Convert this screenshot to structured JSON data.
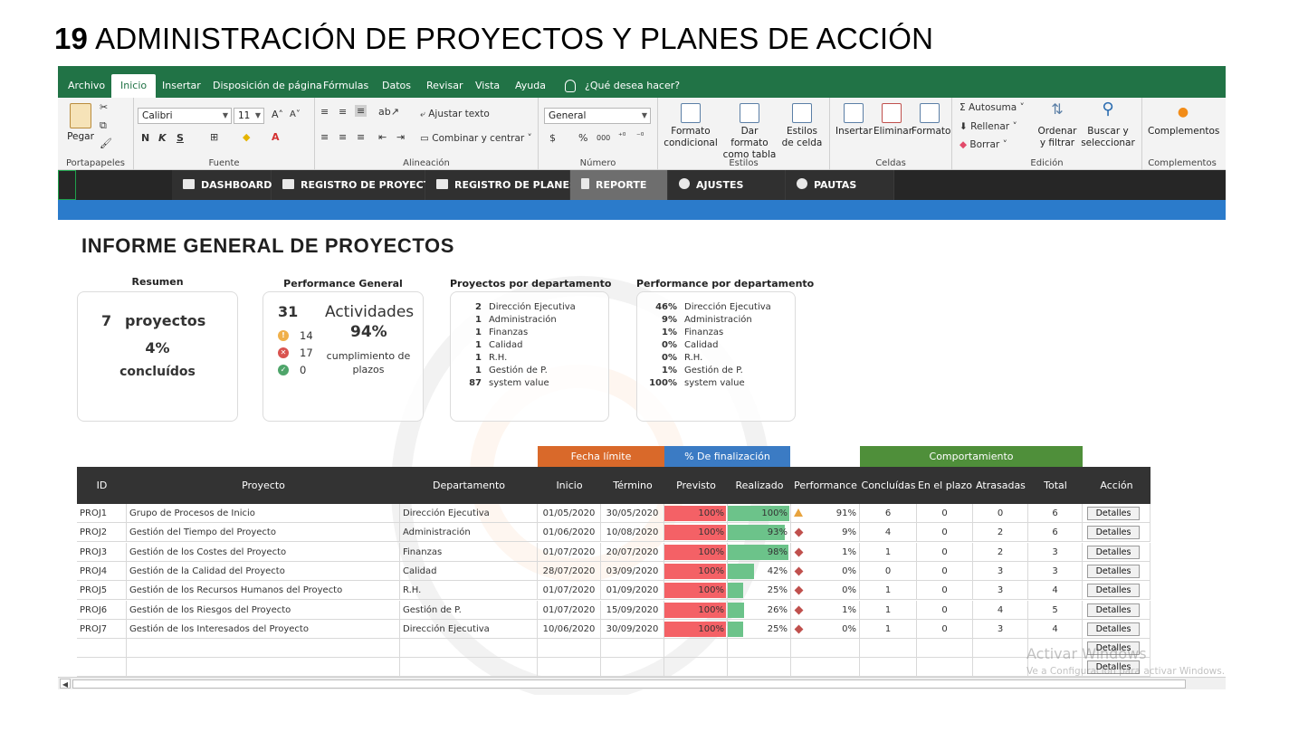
{
  "slide": {
    "number": "19",
    "title": "ADMINISTRACIÓN DE PROYECTOS Y PLANES DE ACCIÓN"
  },
  "ribbon_tabs": [
    "Archivo",
    "Inicio",
    "Insertar",
    "Disposición de página",
    "Fórmulas",
    "Datos",
    "Revisar",
    "Vista",
    "Ayuda",
    "¿Qué desea hacer?"
  ],
  "active_tab": "Inicio",
  "ribbon": {
    "portapapeles": {
      "paste": "Pegar",
      "label": "Portapapeles"
    },
    "fuente": {
      "font": "Calibri",
      "size": "11",
      "label": "Fuente",
      "bold": "N",
      "italic": "K",
      "underline": "S"
    },
    "alineacion": {
      "wrap": "Ajustar texto",
      "merge": "Combinar y centrar",
      "label": "Alineación"
    },
    "numero": {
      "format": "General",
      "currency": "$",
      "percent": "%",
      "thousands": "000",
      "label": "Número"
    },
    "estilos": {
      "cond": "Formato condicional",
      "table": "Dar formato como tabla",
      "cell": "Estilos de celda",
      "label": "Estilos"
    },
    "celdas": {
      "insert": "Insertar",
      "delete": "Eliminar",
      "format": "Formato",
      "label": "Celdas"
    },
    "edicion": {
      "autosum": "Autosuma",
      "fill": "Rellenar",
      "clear": "Borrar",
      "sort": "Ordenar y filtrar",
      "find": "Buscar y seleccionar",
      "label": "Edición"
    },
    "complementos": {
      "addins": "Complementos",
      "label": "Complementos"
    }
  },
  "nav": [
    "DASHBOARD",
    "REGISTRO DE PROYECTOS",
    "REGISTRO DE PLANES",
    "REPORTE",
    "AJUSTES",
    "PAUTAS"
  ],
  "nav_active": "REPORTE",
  "report_title": "INFORME GENERAL DE PROYECTOS",
  "summary": {
    "head": "Resumen",
    "count": "7",
    "word": "proyectos",
    "pct": "4%",
    "label": "concluídos"
  },
  "performance": {
    "head": "Performance General",
    "total": "31",
    "activities": "Actividades",
    "pct": "94%",
    "label": "cumplimiento de plazos",
    "pending": "14",
    "late": "17",
    "done": "0",
    "colors": {
      "pending": "#f0b04a",
      "late": "#d9534f",
      "done": "#4ea56a"
    }
  },
  "by_dept": {
    "head": "Proyectos por departamento",
    "items": [
      {
        "n": "2",
        "name": "Dirección Ejecutiva"
      },
      {
        "n": "1",
        "name": "Administración"
      },
      {
        "n": "1",
        "name": "Finanzas"
      },
      {
        "n": "1",
        "name": "Calidad"
      },
      {
        "n": "1",
        "name": "R.H."
      },
      {
        "n": "1",
        "name": "Gestión de P."
      },
      {
        "n": "87",
        "name": "system value"
      }
    ]
  },
  "perf_dept": {
    "head": "Performance por departamento",
    "items": [
      {
        "n": "46%",
        "name": "Dirección Ejecutiva"
      },
      {
        "n": "9%",
        "name": "Administración"
      },
      {
        "n": "1%",
        "name": "Finanzas"
      },
      {
        "n": "0%",
        "name": "Calidad"
      },
      {
        "n": "0%",
        "name": "R.H."
      },
      {
        "n": "1%",
        "name": "Gestión de P."
      },
      {
        "n": "100%",
        "name": "system value"
      }
    ]
  },
  "table": {
    "groups": {
      "fecha": "Fecha límite",
      "pct": "% De finalización",
      "comp": "Comportamiento"
    },
    "group_colors": {
      "fecha": "#d9692a",
      "pct": "#3b7bc4",
      "comp": "#4f8f3a"
    },
    "headers": [
      "ID",
      "Proyecto",
      "Departamento",
      "Inicio",
      "Término",
      "Previsto",
      "Realizado",
      "Performance",
      "Concluídas",
      "En el plazo",
      "Atrasadas",
      "Total",
      "Acción"
    ],
    "button_label": "Detalles",
    "rows": [
      {
        "id": "PROJ1",
        "proyecto": "Grupo de Procesos de Inicio",
        "depto": "Dirección Ejecutiva",
        "inicio": "01/05/2020",
        "termino": "30/05/2020",
        "previsto": "100%",
        "previsto_v": 1.0,
        "realizado": "100%",
        "realizado_v": 1.0,
        "perf": "91%",
        "perf_icon": "warning",
        "concl": "6",
        "plazo": "0",
        "atras": "0",
        "total": "6"
      },
      {
        "id": "PROJ2",
        "proyecto": "Gestión del Tiempo del Proyecto",
        "depto": "Administración",
        "inicio": "01/06/2020",
        "termino": "10/08/2020",
        "previsto": "100%",
        "previsto_v": 1.0,
        "realizado": "93%",
        "realizado_v": 0.93,
        "perf": "9%",
        "perf_icon": "diamond",
        "concl": "4",
        "plazo": "0",
        "atras": "2",
        "total": "6"
      },
      {
        "id": "PROJ3",
        "proyecto": "Gestión de los Costes del Proyecto",
        "depto": "Finanzas",
        "inicio": "01/07/2020",
        "termino": "20/07/2020",
        "previsto": "100%",
        "previsto_v": 1.0,
        "realizado": "98%",
        "realizado_v": 0.98,
        "perf": "1%",
        "perf_icon": "diamond",
        "concl": "1",
        "plazo": "0",
        "atras": "2",
        "total": "3"
      },
      {
        "id": "PROJ4",
        "proyecto": "Gestión de la Calidad del Proyecto",
        "depto": "Calidad",
        "inicio": "28/07/2020",
        "termino": "03/09/2020",
        "previsto": "100%",
        "previsto_v": 1.0,
        "realizado": "42%",
        "realizado_v": 0.42,
        "perf": "0%",
        "perf_icon": "diamond",
        "concl": "0",
        "plazo": "0",
        "atras": "3",
        "total": "3"
      },
      {
        "id": "PROJ5",
        "proyecto": "Gestión de los Recursos Humanos del Proyecto",
        "depto": "R.H.",
        "inicio": "01/07/2020",
        "termino": "01/09/2020",
        "previsto": "100%",
        "previsto_v": 1.0,
        "realizado": "25%",
        "realizado_v": 0.25,
        "perf": "0%",
        "perf_icon": "diamond",
        "concl": "1",
        "plazo": "0",
        "atras": "3",
        "total": "4"
      },
      {
        "id": "PROJ6",
        "proyecto": "Gestión de los Riesgos del Proyecto",
        "depto": "Gestión de P.",
        "inicio": "01/07/2020",
        "termino": "15/09/2020",
        "previsto": "100%",
        "previsto_v": 1.0,
        "realizado": "26%",
        "realizado_v": 0.26,
        "perf": "1%",
        "perf_icon": "diamond",
        "concl": "1",
        "plazo": "0",
        "atras": "4",
        "total": "5"
      },
      {
        "id": "PROJ7",
        "proyecto": "Gestión de los Interesados del Proyecto",
        "depto": "Dirección Ejecutiva",
        "inicio": "10/06/2020",
        "termino": "30/09/2020",
        "previsto": "100%",
        "previsto_v": 1.0,
        "realizado": "25%",
        "realizado_v": 0.25,
        "perf": "0%",
        "perf_icon": "diamond",
        "concl": "1",
        "plazo": "0",
        "atras": "3",
        "total": "4"
      }
    ],
    "empty_rows": 2,
    "colors": {
      "previsto_bar": "#f46166",
      "realizado_bar": "#6cc38a",
      "perf_icon": "#c0504d"
    }
  },
  "watermark": {
    "line1": "Activar Windows",
    "line2": "Ve a Configuración para activar Windows."
  }
}
